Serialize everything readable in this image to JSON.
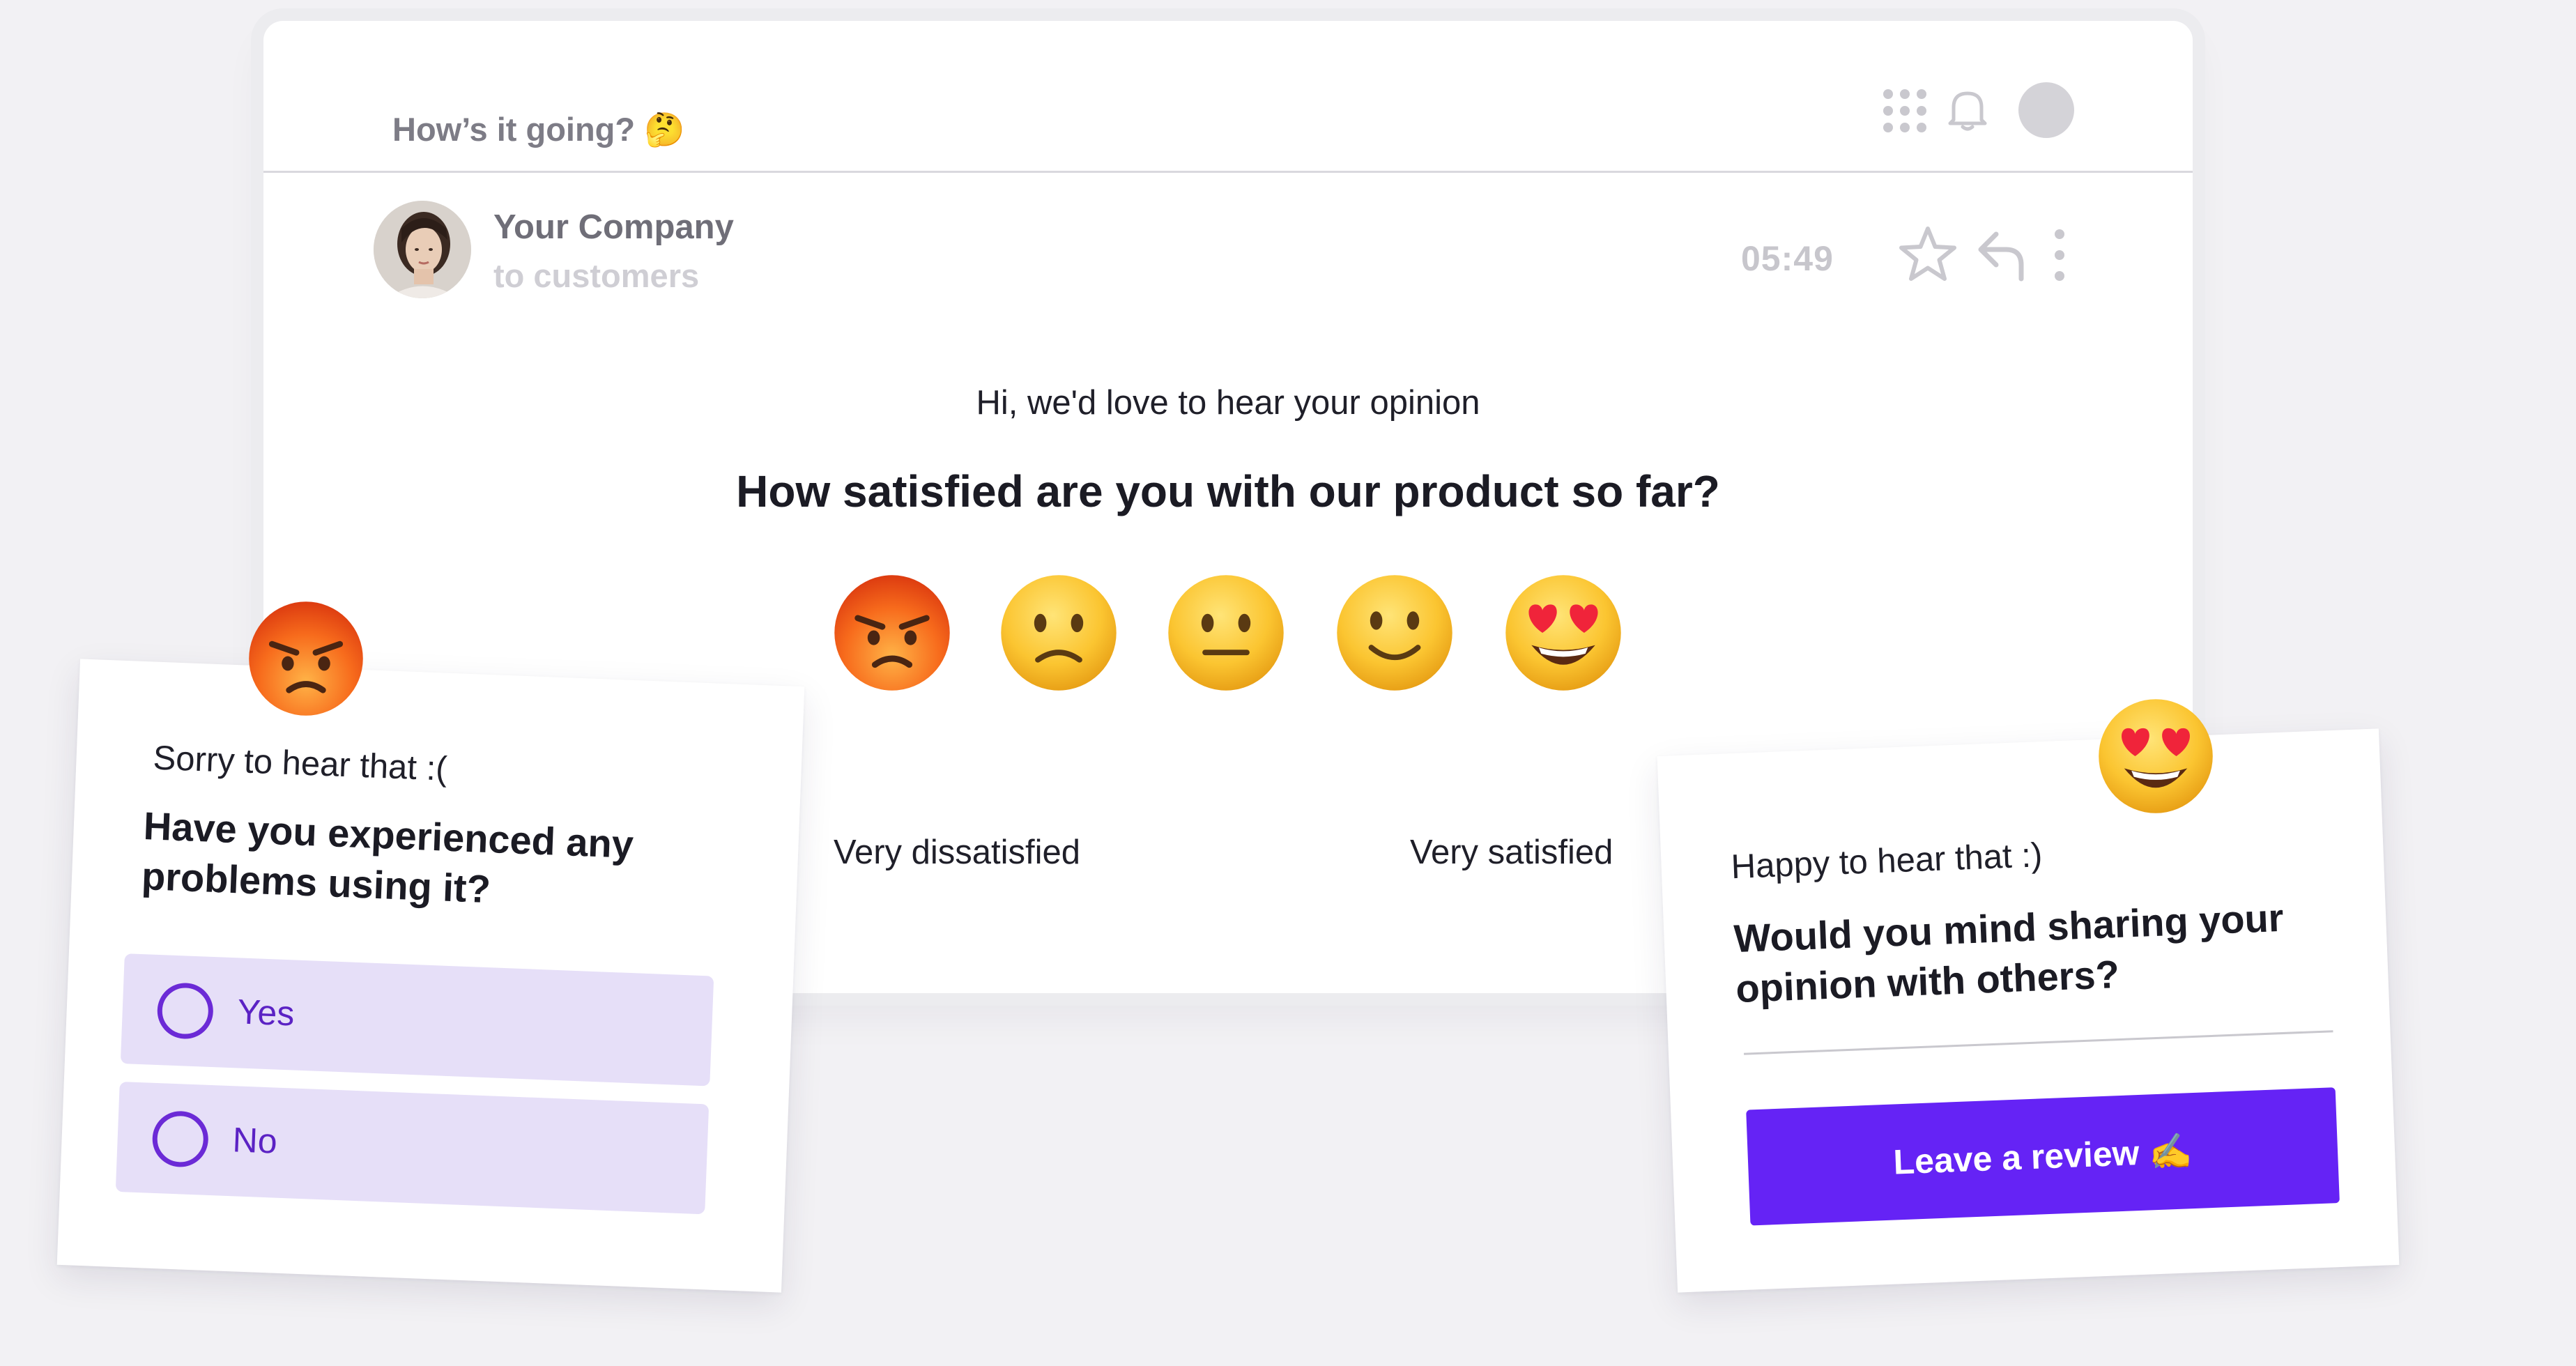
{
  "email": {
    "subject": "How’s it going? 🤔",
    "sender_name": "Your Company",
    "sender_to": "to customers",
    "time": "05:49",
    "greeting": "Hi, we'd love to hear your opinion",
    "question": "How satisfied are you with our product so far?",
    "rating": {
      "options": [
        "angry-face",
        "frowning-face",
        "neutral-face",
        "slightly-smiling-face",
        "heart-eyes-face"
      ],
      "low_label": "Very dissatisfied",
      "high_label": "Very satisfied"
    }
  },
  "negative_card": {
    "subtitle": "Sorry to hear that :(",
    "question": "Have you experienced any problems using it?",
    "options": [
      "Yes",
      "No"
    ],
    "emoji": "angry-face"
  },
  "positive_card": {
    "subtitle": "Happy to hear that :)",
    "question": "Would you mind sharing your opinion with others?",
    "button": "Leave a review ✍️",
    "emoji": "heart-eyes-face"
  },
  "colors": {
    "accent": "#6523f5",
    "option_bg": "#e6dff8",
    "radio": "#6b2ad6"
  }
}
